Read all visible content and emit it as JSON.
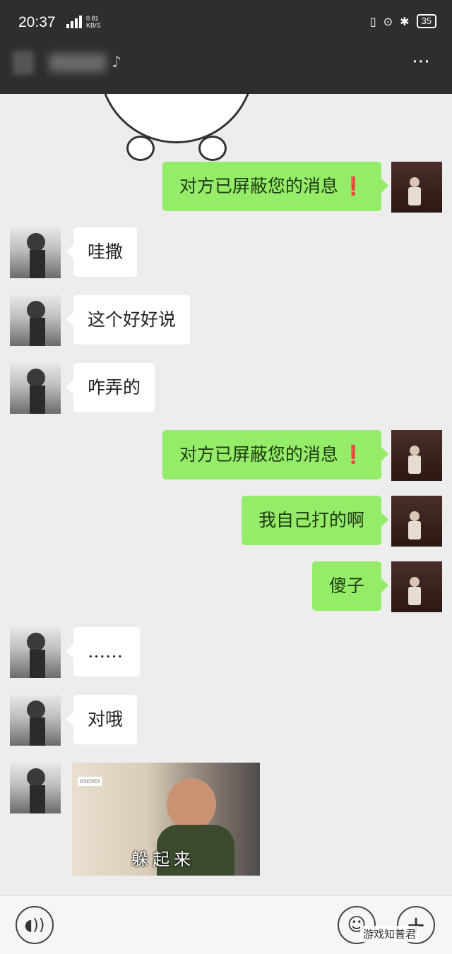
{
  "status_bar": {
    "time": "20:37",
    "network": "4G",
    "net_speed_value": "0.81",
    "net_speed_unit": "KB/S",
    "battery": "35"
  },
  "header": {
    "more_icon": "⋯"
  },
  "messages": [
    {
      "side": "self",
      "text": "对方已屏蔽您的消息",
      "alert": "❗"
    },
    {
      "side": "other",
      "text": "哇撒"
    },
    {
      "side": "other",
      "text": "这个好好说"
    },
    {
      "side": "other",
      "text": "咋弄的"
    },
    {
      "side": "self",
      "text": "对方已屏蔽您的消息",
      "alert": "❗"
    },
    {
      "side": "self",
      "text": "我自己打的啊"
    },
    {
      "side": "self",
      "text": "傻子"
    },
    {
      "side": "other",
      "text": "……"
    },
    {
      "side": "other",
      "text": "对哦"
    },
    {
      "side": "other",
      "type": "gif",
      "caption": "躲起来"
    }
  ],
  "input_bar": {
    "voice_icon": "voice-icon",
    "emoji_icon": "emoji-icon",
    "plus_icon": "plus-icon"
  },
  "watermark": "游戏知普君"
}
